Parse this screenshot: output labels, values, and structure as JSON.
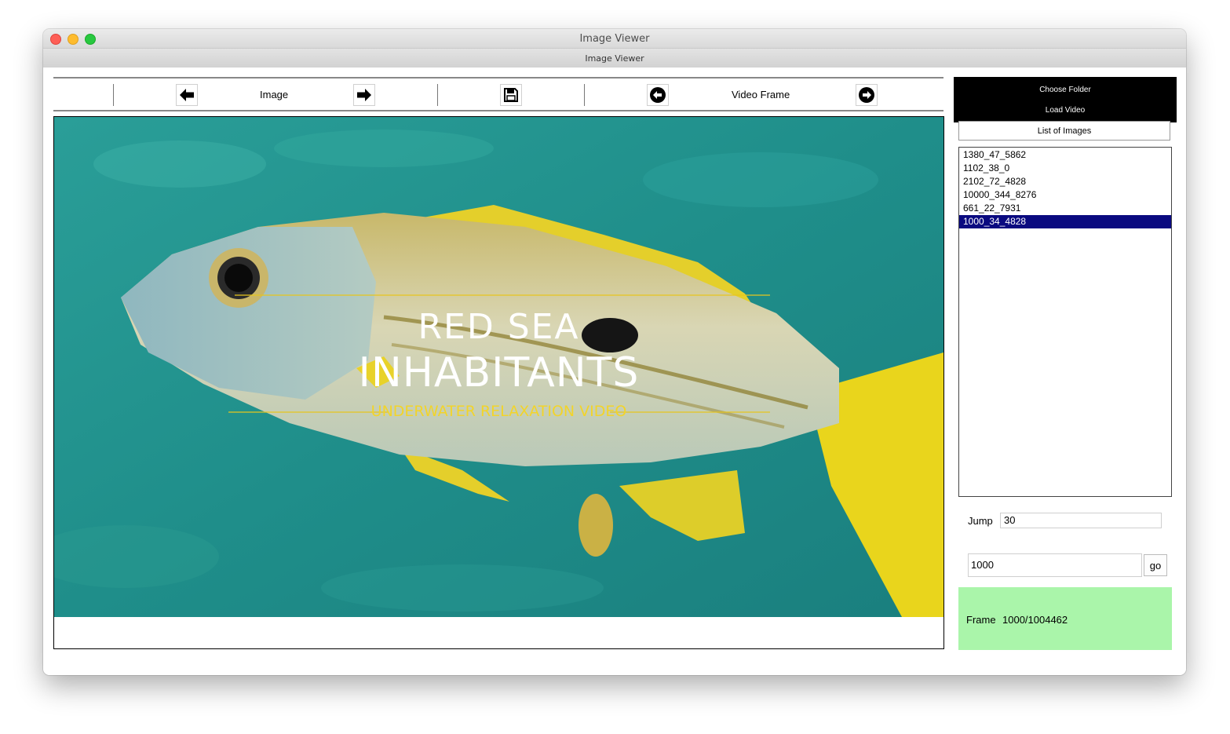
{
  "window": {
    "title": "Image Viewer",
    "subtitle": "Image Viewer"
  },
  "toolbar": {
    "image_label": "Image",
    "video_frame_label": "Video Frame",
    "icons": [
      "arrow-left-icon",
      "arrow-right-icon",
      "save-icon",
      "circle-arrow-left-icon",
      "circle-arrow-right-icon"
    ]
  },
  "viewer": {
    "overlay": {
      "line1": "RED SEA",
      "line2": "INHABITANTS",
      "line3": "UNDERWATER RELAXATION VIDEO"
    }
  },
  "sidebar": {
    "choose_folder": "Choose Folder",
    "load_video": "Load Video",
    "list_header": "List of Images",
    "images": [
      "1380_47_5862",
      "1102_38_0",
      "2102_72_4828",
      "10000_344_8276",
      "661_22_7931",
      "1000_34_4828"
    ],
    "selected_index": 5,
    "jump_label": "Jump",
    "jump_value": "30",
    "frame_input_value": "1000",
    "go_label": "go",
    "frame_label": "Frame",
    "frame_value": "1000/1004462",
    "status_color": "#aaf5aa",
    "selection_color": "#0a0a80"
  }
}
